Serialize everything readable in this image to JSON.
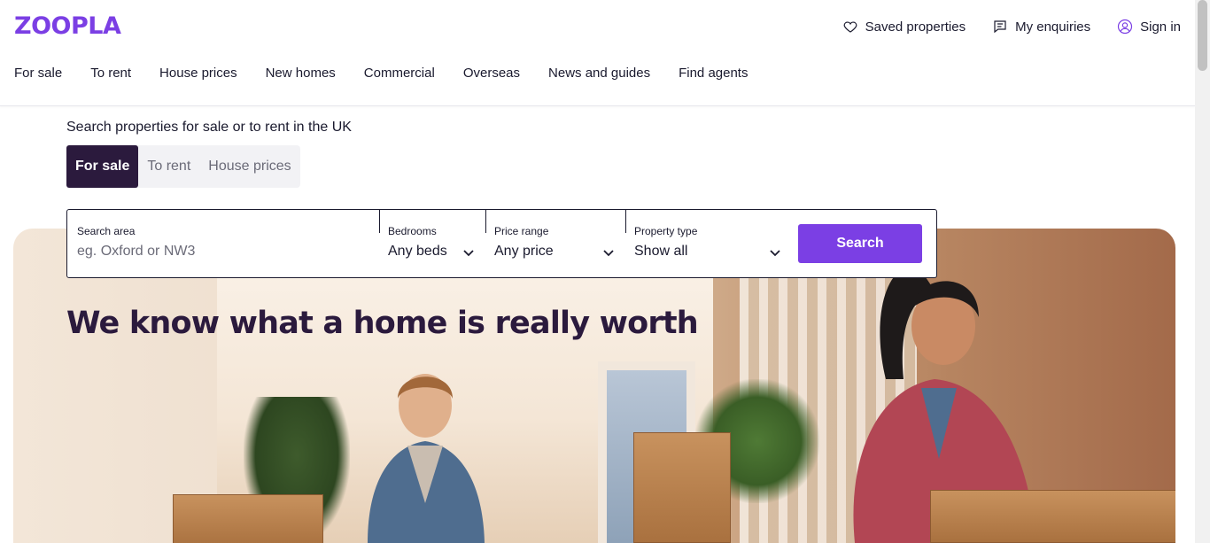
{
  "brand": {
    "logo_text": "ZOOPLA",
    "accent_color": "#7b3fe4",
    "dark_color": "#2b1a3d"
  },
  "utility_nav": {
    "saved": {
      "label": "Saved properties",
      "icon": "heart-icon"
    },
    "enquiries": {
      "label": "My enquiries",
      "icon": "message-icon"
    },
    "signin": {
      "label": "Sign in",
      "icon": "user-icon"
    }
  },
  "main_nav": {
    "items": [
      {
        "label": "For sale"
      },
      {
        "label": "To rent"
      },
      {
        "label": "House prices"
      },
      {
        "label": "New homes"
      },
      {
        "label": "Commercial"
      },
      {
        "label": "Overseas"
      },
      {
        "label": "News and guides"
      },
      {
        "label": "Find agents"
      }
    ]
  },
  "search": {
    "heading": "Search properties for sale or to rent in the UK",
    "tabs": [
      {
        "label": "For sale",
        "active": true
      },
      {
        "label": "To rent",
        "active": false
      },
      {
        "label": "House prices",
        "active": false
      }
    ],
    "area": {
      "label": "Search area",
      "placeholder": "eg. Oxford or NW3"
    },
    "bedrooms": {
      "label": "Bedrooms",
      "value": "Any beds"
    },
    "price": {
      "label": "Price range",
      "value": "Any price"
    },
    "type": {
      "label": "Property type",
      "value": "Show all"
    },
    "button_label": "Search"
  },
  "hero": {
    "title": "We know what a home is really worth"
  }
}
